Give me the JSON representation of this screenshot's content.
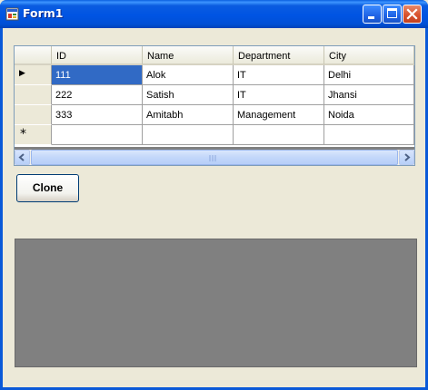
{
  "window": {
    "title": "Form1"
  },
  "grid": {
    "columns": [
      "ID",
      "Name",
      "Department",
      "City"
    ],
    "rows": [
      {
        "id": "111",
        "name": "Alok",
        "department": "IT",
        "city": "Delhi"
      },
      {
        "id": "222",
        "name": "Satish",
        "department": "IT",
        "city": "Jhansi"
      },
      {
        "id": "333",
        "name": "Amitabh",
        "department": "Management",
        "city": "Noida"
      }
    ],
    "selected_cell": "111",
    "new_row_marker": "*",
    "current_row_marker": "▶"
  },
  "buttons": {
    "clone_label": "Clone"
  },
  "colors": {
    "selection": "#316AC5",
    "panel": "#808080",
    "titlebar": "#0054E3"
  }
}
